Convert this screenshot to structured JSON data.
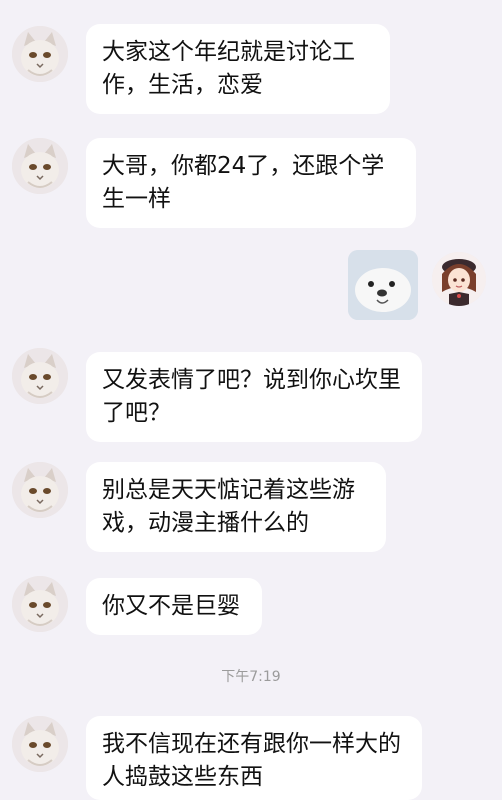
{
  "messages": [
    {
      "side": "left",
      "text": "大家这个年纪就是讨论工作，生活，恋爱"
    },
    {
      "side": "left",
      "text": "大哥，你都24了，还跟个学生一样"
    },
    {
      "side": "right",
      "type": "sticker",
      "sticker": "white-dog-meme-icon"
    },
    {
      "side": "left",
      "text": "又发表情了吧？说到你心坎里了吧？"
    },
    {
      "side": "left",
      "text": "别总是天天惦记着这些游戏，动漫主播什么的"
    },
    {
      "side": "left",
      "text": "你又不是巨婴"
    },
    {
      "side": "left",
      "text": "我不信现在还有跟你一样大的人捣鼓这些东西"
    }
  ],
  "timestamp": "下午7:19",
  "colors": {
    "background": "#f3f1f7",
    "bubble": "#ffffff",
    "text": "#111111",
    "timestamp": "#9b9b9b"
  }
}
